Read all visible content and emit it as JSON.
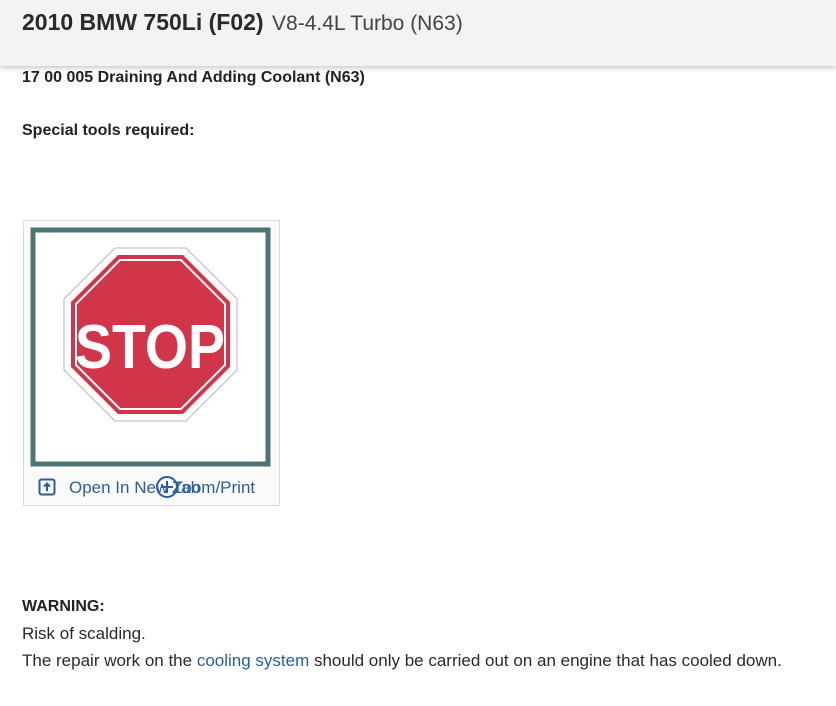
{
  "header": {
    "vehicle": "2010 BMW 750Li (F02)",
    "engine": "V8-4.4L Turbo (N63)"
  },
  "procedure": {
    "title": "17 00 005 Draining And Adding Coolant (N63)",
    "special_tools": "Special tools required:"
  },
  "figure": {
    "sign_text": "STOP",
    "open_label": "Open In New Tab",
    "zoom_label": "Zoom/Print",
    "colors": {
      "sign_red": "#d0354a",
      "frame": "#4d7473",
      "link": "#2a5d9f"
    }
  },
  "warning": {
    "heading": "WARNING:",
    "line1": "Risk of scalding.",
    "line2_before": "The repair work on the ",
    "line2_link": "cooling system",
    "line2_after": " should only be carried out on an engine that has cooled down."
  }
}
